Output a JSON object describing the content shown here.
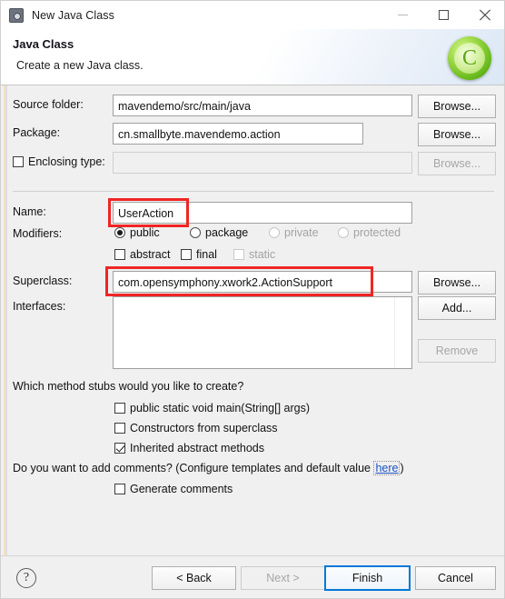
{
  "window": {
    "title": "New Java Class",
    "icon": "java-class-wizard-icon",
    "minimize_label": "—",
    "maximize_label": "□",
    "close_label": "✕"
  },
  "header": {
    "title": "Java Class",
    "description": "Create a new Java class.",
    "logo_letter": "C",
    "logo_icon": "green-class-circle-icon"
  },
  "form": {
    "source_folder": {
      "label": "Source folder:",
      "value": "mavendemo/src/main/java",
      "browse_label": "Browse..."
    },
    "package": {
      "label": "Package:",
      "value": "cn.smallbyte.mavendemo.action",
      "browse_label": "Browse..."
    },
    "enclosing_type": {
      "label": "Enclosing type:",
      "checked": false,
      "value": "",
      "browse_label": "Browse...",
      "disabled": true
    },
    "name": {
      "label": "Name:",
      "value": "UserAction",
      "highlighted": true
    },
    "modifiers": {
      "label": "Modifiers:",
      "access": [
        {
          "label": "public",
          "selected": true,
          "disabled": false
        },
        {
          "label": "package",
          "selected": false,
          "disabled": false
        },
        {
          "label": "private",
          "selected": false,
          "disabled": true
        },
        {
          "label": "protected",
          "selected": false,
          "disabled": true
        }
      ],
      "flags": [
        {
          "label": "abstract",
          "checked": false,
          "disabled": false
        },
        {
          "label": "final",
          "checked": false,
          "disabled": false
        },
        {
          "label": "static",
          "checked": false,
          "disabled": true
        }
      ]
    },
    "superclass": {
      "label": "Superclass:",
      "value": "com.opensymphony.xwork2.ActionSupport",
      "browse_label": "Browse...",
      "highlighted": true
    },
    "interfaces": {
      "label": "Interfaces:",
      "items": [],
      "add_label": "Add...",
      "remove_label": "Remove",
      "remove_disabled": true
    }
  },
  "stubs": {
    "question": "Which method stubs would you like to create?",
    "options": [
      {
        "label": "public static void main(String[] args)",
        "checked": false
      },
      {
        "label": "Constructors from superclass",
        "checked": false
      },
      {
        "label": "Inherited abstract methods",
        "checked": true
      }
    ]
  },
  "comments": {
    "question_prefix": "Do you want to add comments? (Configure templates and default value ",
    "link_label": "here",
    "question_suffix": ")",
    "option": {
      "label": "Generate comments",
      "checked": false
    }
  },
  "footer": {
    "help_label": "?",
    "back_label": "< Back",
    "next_label": "Next >",
    "next_disabled": true,
    "finish_label": "Finish",
    "finish_focused": true,
    "cancel_label": "Cancel"
  },
  "annotations": {
    "accent_color": "#f02525",
    "focus_color": "#0078d7"
  }
}
